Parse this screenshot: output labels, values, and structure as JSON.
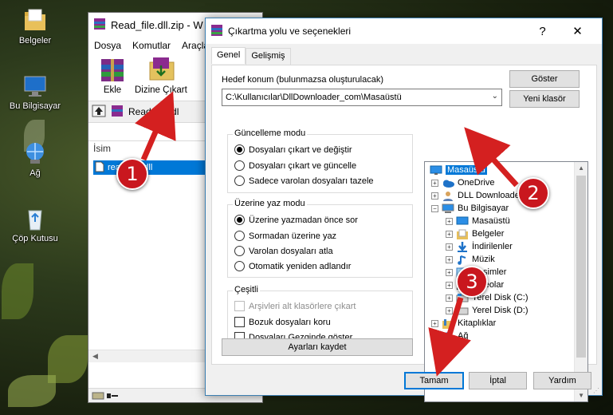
{
  "desktop": {
    "icons": [
      {
        "label": "Belgeler",
        "icon": "folder-icon"
      },
      {
        "label": "Bu Bilgisayar",
        "icon": "computer-icon"
      },
      {
        "label": "Ağ",
        "icon": "network-icon"
      },
      {
        "label": "Çöp Kutusu",
        "icon": "recycle-bin-icon"
      }
    ]
  },
  "winrar": {
    "title": "Read_file.dll.zip - W",
    "menu": [
      "Dosya",
      "Komutlar",
      "Araçla"
    ],
    "toolbar": {
      "add_label": "Ekle",
      "extract_label": "Dizine Çıkart"
    },
    "path": "Read_file.dl",
    "list_header": "İsim",
    "file": "read_file.dll"
  },
  "dialog": {
    "title": "Çıkartma yolu ve seçenekleri",
    "help_glyph": "?",
    "close_glyph": "✕",
    "tabs": [
      "Genel",
      "Gelişmiş"
    ],
    "target_label": "Hedef konum (bulunmazsa oluşturulacak)",
    "target_path": "C:\\Kullanıcılar\\DllDownloader_com\\Masaüstü",
    "show_button": "Göster",
    "new_folder_button": "Yeni klasör",
    "update_mode": {
      "title": "Güncelleme modu",
      "options": [
        "Dosyaları çıkart ve değiştir",
        "Dosyaları çıkart ve güncelle",
        "Sadece varolan dosyaları tazele"
      ],
      "selected": 0
    },
    "overwrite_mode": {
      "title": "Üzerine yaz modu",
      "options": [
        "Üzerine yazmadan önce sor",
        "Sormadan üzerine yaz",
        "Varolan dosyaları atla",
        "Otomatik yeniden adlandır"
      ],
      "selected": 0
    },
    "misc": {
      "title": "Çeşitli",
      "options": [
        "Arşivleri alt klasörlere çıkart",
        "Bozuk dosyaları koru",
        "Dosyaları Gezginde göster"
      ],
      "disabled": [
        true,
        false,
        false
      ]
    },
    "save_settings_button": "Ayarları kaydet",
    "tree": [
      {
        "label": "Masaüstü",
        "icon": "desktop-icon",
        "selected": true
      },
      {
        "label": "OneDrive",
        "icon": "onedrive-icon"
      },
      {
        "label": "DLL Downloader.com",
        "icon": "user-icon"
      },
      {
        "label": "Bu Bilgisayar",
        "icon": "computer-icon"
      },
      {
        "label": "Masaüstü",
        "icon": "desktop-icon"
      },
      {
        "label": "Belgeler",
        "icon": "documents-icon"
      },
      {
        "label": "İndirilenler",
        "icon": "downloads-icon"
      },
      {
        "label": "Müzik",
        "icon": "music-icon"
      },
      {
        "label": "Resimler",
        "icon": "pictures-icon"
      },
      {
        "label": "Videolar",
        "icon": "videos-icon"
      },
      {
        "label": "Yerel Disk (C:)",
        "icon": "drive-icon"
      },
      {
        "label": "Yerel Disk (D:)",
        "icon": "drive-icon"
      },
      {
        "label": "Kitaplıklar",
        "icon": "libraries-icon"
      },
      {
        "label": "Ağ",
        "icon": "network-icon"
      }
    ],
    "ok_button": "Tamam",
    "cancel_button": "İptal",
    "help_button": "Yardım"
  },
  "annotations": [
    "1",
    "2",
    "3"
  ],
  "colors": {
    "accent": "#0078d7",
    "annotation": "#c9171e"
  }
}
